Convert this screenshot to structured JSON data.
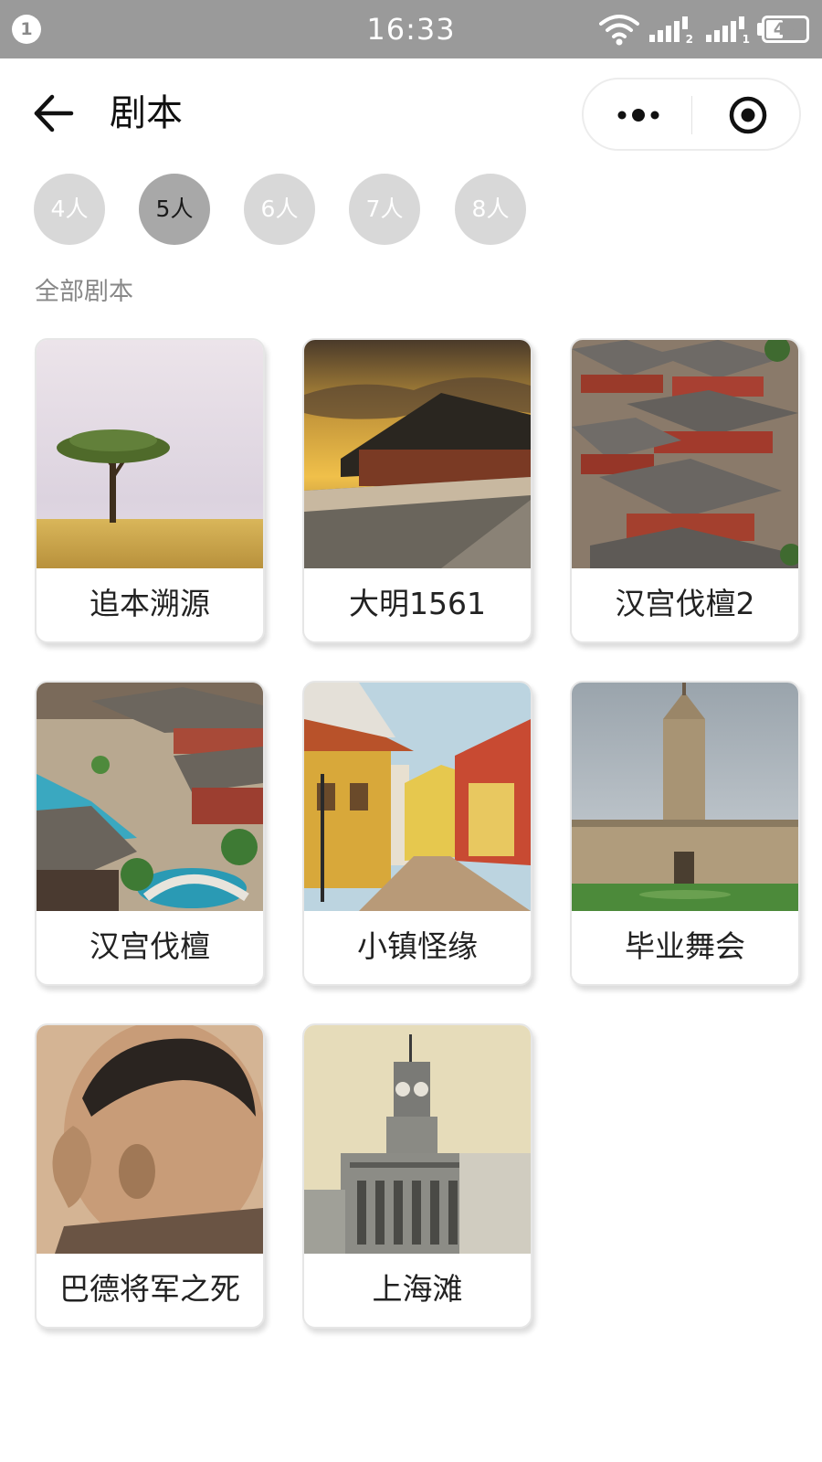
{
  "status_bar": {
    "notification_count": "1",
    "time": "16:33",
    "sim2_label": "2",
    "sim1_label": "1",
    "battery_level": "42",
    "battery_fraction": 0.42
  },
  "nav": {
    "title": "剧本",
    "back_icon": "arrow-left-icon",
    "more_icon": "more-dots-icon",
    "close_icon": "target-close-icon"
  },
  "filters": [
    {
      "label": "4人",
      "active": false
    },
    {
      "label": "5人",
      "active": true
    },
    {
      "label": "6人",
      "active": false
    },
    {
      "label": "7人",
      "active": false
    },
    {
      "label": "8人",
      "active": false
    }
  ],
  "section_title": "全部剧本",
  "scripts": [
    {
      "title": "追本溯源",
      "image": "savanna-tree"
    },
    {
      "title": "大明1561",
      "image": "palace-sunset"
    },
    {
      "title": "汉宫伐檀2",
      "image": "palace-rooftops"
    },
    {
      "title": "汉宫伐檀",
      "image": "palace-miniature"
    },
    {
      "title": "小镇怪缘",
      "image": "town-street-painting"
    },
    {
      "title": "毕业舞会",
      "image": "college-tower"
    },
    {
      "title": "巴德将军之死",
      "image": "portrait-sketch"
    },
    {
      "title": "上海滩",
      "image": "clock-tower-building"
    }
  ],
  "colors": {
    "status_bar_bg": "#9a9a9a",
    "chip_bg": "#d8d8d8",
    "chip_active_bg": "#a8a8a8",
    "section_text": "#888888"
  }
}
